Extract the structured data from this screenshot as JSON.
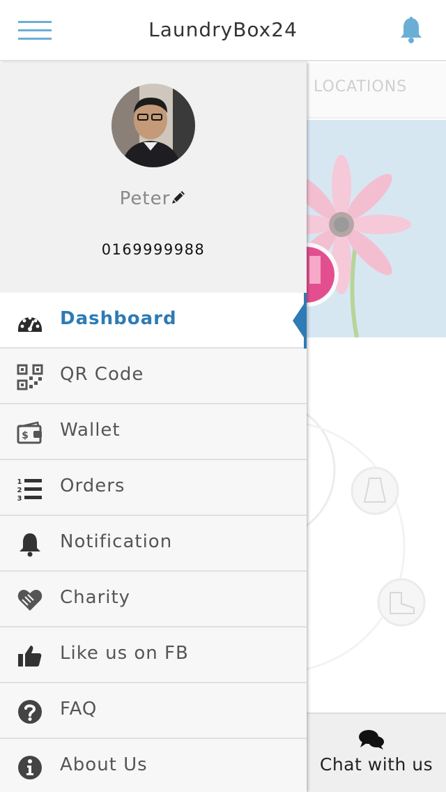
{
  "header": {
    "title": "LaundryBox24"
  },
  "background": {
    "tab_label": "LOCATIONS",
    "chat_label": "Chat with us"
  },
  "profile": {
    "name": "Peter",
    "phone": "0169999988"
  },
  "menu": [
    {
      "label": "Dashboard",
      "icon": "dashboard-icon",
      "active": true
    },
    {
      "label": "QR Code",
      "icon": "qr-code-icon"
    },
    {
      "label": "Wallet",
      "icon": "wallet-icon"
    },
    {
      "label": "Orders",
      "icon": "orders-list-icon"
    },
    {
      "label": "Notification",
      "icon": "bell-icon"
    },
    {
      "label": "Charity",
      "icon": "charity-heart-icon"
    },
    {
      "label": "Like us on FB",
      "icon": "thumbs-up-icon"
    },
    {
      "label": "FAQ",
      "icon": "question-icon"
    },
    {
      "label": "About Us",
      "icon": "info-icon"
    }
  ],
  "colors": {
    "accent": "#2e7bb5",
    "hamburger": "#6aaed6"
  }
}
